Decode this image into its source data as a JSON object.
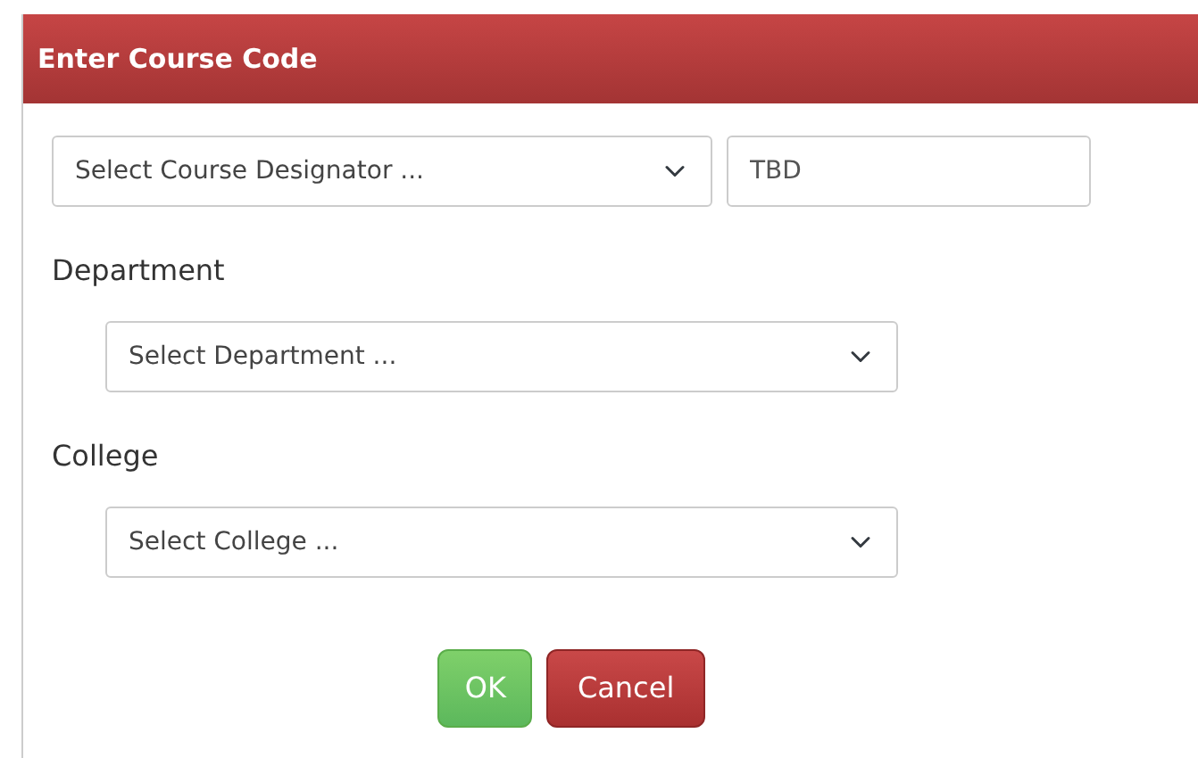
{
  "dialog": {
    "title": "Enter Course Code"
  },
  "designator": {
    "placeholder": "Select Course Designator ..."
  },
  "code": {
    "value": "TBD"
  },
  "fields": [
    {
      "label": "Department",
      "placeholder": "Select Department ..."
    },
    {
      "label": "College",
      "placeholder": "Select College ..."
    }
  ],
  "buttons": [
    {
      "label": "OK",
      "kind": "ok"
    },
    {
      "label": "Cancel",
      "kind": "cancel"
    }
  ]
}
